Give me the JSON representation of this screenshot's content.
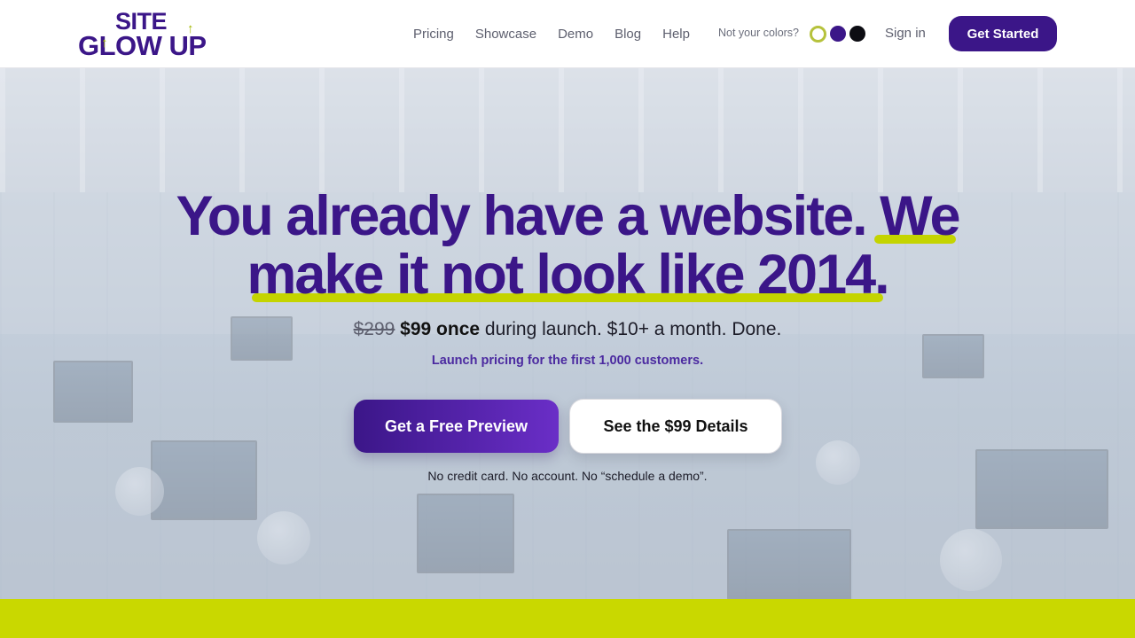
{
  "logo": {
    "line1": "SITE",
    "line2": "GLOW UP",
    "arrow_icon": "↑"
  },
  "nav": {
    "items": [
      "Pricing",
      "Showcase",
      "Demo",
      "Blog",
      "Help"
    ]
  },
  "color_picker": {
    "label": "Not your colors?",
    "swatches": [
      "#c4d400",
      "#3b1688",
      "#0c0c12"
    ]
  },
  "header": {
    "signin": "Sign in",
    "cta": "Get Started"
  },
  "hero": {
    "headline_line1_a": "You already have a website. ",
    "headline_line1_b": "We",
    "headline_line2": "make it not look like 2014.",
    "old_price": "$299",
    "new_price": "$99 once",
    "price_rest": " during launch. $10+ a month. Done.",
    "launch_note": "Launch pricing for the first 1,000 customers.",
    "primary_button": "Get a Free Preview",
    "secondary_button": "See the $99 Details",
    "fine_print": "No credit card. No account. No “schedule a demo”."
  },
  "colors": {
    "brand_purple": "#3b1688",
    "accent_lime": "#c9d800",
    "band": "#c9d800"
  }
}
